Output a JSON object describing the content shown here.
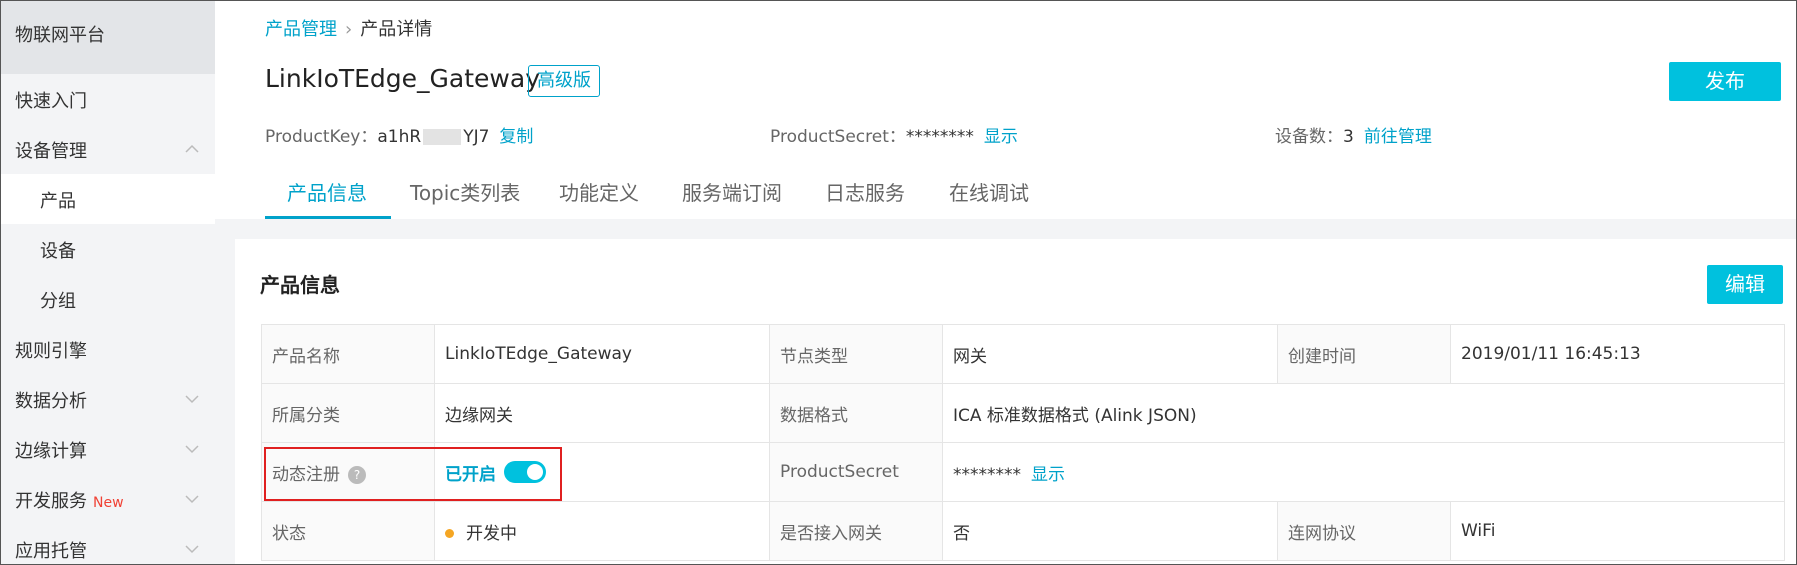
{
  "sidebar": {
    "title": "物联网平台",
    "items": [
      {
        "label": "快速入门"
      },
      {
        "label": "设备管理"
      },
      {
        "label": "产品"
      },
      {
        "label": "设备"
      },
      {
        "label": "分组"
      },
      {
        "label": "规则引擎"
      },
      {
        "label": "数据分析"
      },
      {
        "label": "边缘计算"
      },
      {
        "label": "开发服务",
        "badge": "New"
      },
      {
        "label": "应用托管"
      }
    ]
  },
  "breadcrumb": {
    "parent": "产品管理",
    "separator": "›",
    "current": "产品详情"
  },
  "product": {
    "name": "LinkIoTEdge_Gateway",
    "edition": "高级版",
    "publish_label": "发布",
    "key_label": "ProductKey：",
    "key_prefix": "a1hR",
    "key_suffix": "YJ7",
    "copy_label": "复制",
    "secret_label": "ProductSecret：",
    "secret_value": "********",
    "show_label": "显示",
    "device_count_label": "设备数：",
    "device_count": "3",
    "manage_label": "前往管理"
  },
  "tabs": [
    {
      "label": "产品信息",
      "active": true
    },
    {
      "label": "Topic类列表"
    },
    {
      "label": "功能定义"
    },
    {
      "label": "服务端订阅"
    },
    {
      "label": "日志服务"
    },
    {
      "label": "在线调试"
    }
  ],
  "info": {
    "title": "产品信息",
    "edit_label": "编辑",
    "rows": [
      [
        {
          "k": "产品名称",
          "v": "LinkIoTEdge_Gateway"
        },
        {
          "k": "节点类型",
          "v": "网关"
        },
        {
          "k": "创建时间",
          "v": "2019/01/11 16:45:13"
        }
      ],
      [
        {
          "k": "所属分类",
          "v": "边缘网关"
        },
        {
          "k": "数据格式",
          "v": "ICA 标准数据格式 (Alink JSON)"
        }
      ],
      [
        {
          "k": "动态注册",
          "help": "?",
          "v": "已开启",
          "switch_on": true
        },
        {
          "k": "ProductSecret",
          "v": "********",
          "link": "显示"
        }
      ],
      [
        {
          "k": "状态",
          "v": "开发中"
        },
        {
          "k": "是否接入网关",
          "v": "否"
        },
        {
          "k": "连网协议",
          "v": "WiFi"
        }
      ]
    ]
  },
  "colors": {
    "accent": "#00a2ca",
    "button": "#00c1de",
    "status_dev": "#f5a623",
    "highlight": "#e02020"
  }
}
